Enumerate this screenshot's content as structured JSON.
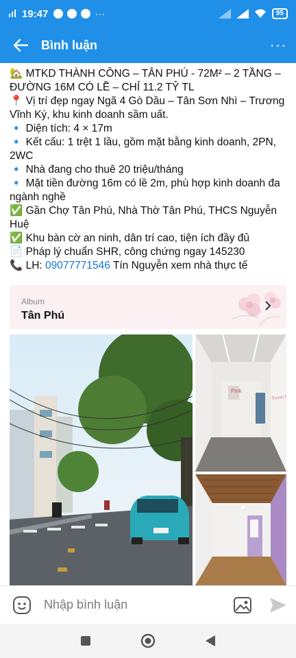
{
  "status_bar": {
    "time": "19:47",
    "battery": "95",
    "more": "···"
  },
  "app_bar": {
    "title": "Bình luận",
    "more": "···"
  },
  "post": {
    "lines": [
      {
        "emoji": "🏡",
        "text": " MTKD THÀNH CÔNG – TÂN PHÚ - 72M² – 2 TẦNG – ĐƯỜNG 16M CÓ LỀ – CHỈ 11.2 TỶ TL"
      },
      {
        "emoji": "📍",
        "text": " Vị trí đẹp ngay Ngã 4 Gò Dầu – Tân Sơn Nhì – Trương Vĩnh Ký, khu kinh doanh sầm uất."
      },
      {
        "emoji": "🔹",
        "text": " Diện tích: 4 × 17m"
      },
      {
        "emoji": "🔹",
        "text": " Kết cấu: 1 trệt 1 lầu, gồm mặt bằng kinh doanh, 2PN, 2WC"
      },
      {
        "emoji": "🔹",
        "text": " Nhà đang cho thuê 20 triệu/tháng"
      },
      {
        "emoji": "🔹",
        "text": " Mặt tiền đường 16m có lề 2m, phù hợp kinh doanh đa ngành nghề"
      },
      {
        "emoji": "✅",
        "text": " Gần Chợ Tân Phú, Nhà Thờ Tân Phú, THCS Nguyễn Huệ"
      },
      {
        "emoji": "✅",
        "text": " Khu bàn cờ an ninh, dân trí cao, tiện ích đầy đủ"
      },
      {
        "emoji": "📄",
        "text": " Pháp lý chuẩn SHR, công chứng ngay 145230"
      }
    ],
    "contact": {
      "emoji": "📞",
      "prefix": " LH: ",
      "phone": "09077771546",
      "suffix": " Tín Nguyễn xem nhà thực tế"
    }
  },
  "album": {
    "label": "Album",
    "name": "Tân Phú"
  },
  "photos": {
    "room1_sign": "Pink",
    "room1_wall_text": "Sweet Home"
  },
  "comment_bar": {
    "placeholder": "Nhập bình luận"
  },
  "colors": {
    "primary": "#1f8fe8",
    "link": "#1677d2",
    "album_bg": "#fbf0f2"
  }
}
